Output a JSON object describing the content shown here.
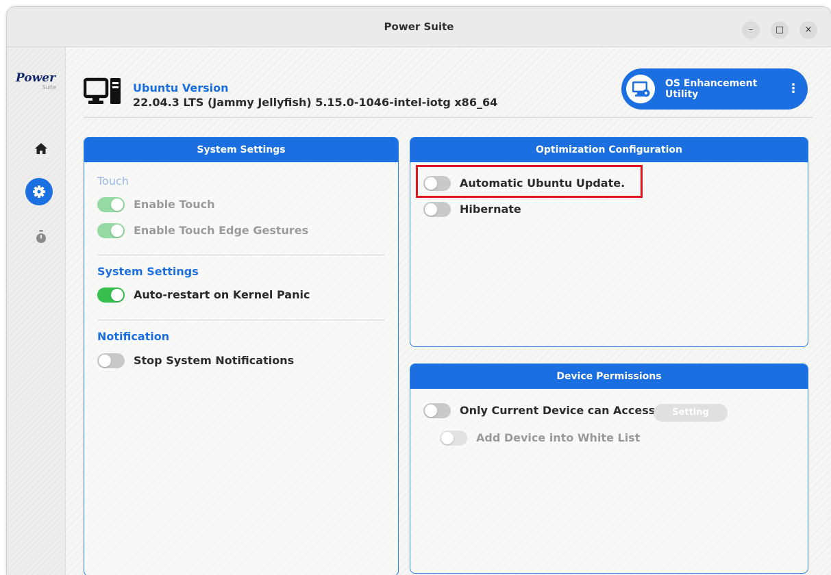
{
  "window": {
    "title": "Power Suite",
    "controls": {
      "minimize": "–",
      "maximize": "□",
      "close": "×"
    }
  },
  "sidebar": {
    "logo": {
      "line1": "Power",
      "line2": "Suite"
    },
    "items": [
      {
        "name": "home",
        "icon": "home-icon",
        "active": false
      },
      {
        "name": "settings",
        "icon": "gear-icon",
        "active": true
      },
      {
        "name": "timer",
        "icon": "stopwatch-icon",
        "active": false
      }
    ]
  },
  "header": {
    "version_label": "Ubuntu Version",
    "version_value": "22.04.3 LTS (Jammy Jellyfish) 5.15.0-1046-intel-iotg x86_64",
    "utility_button": {
      "line1": "OS Enhancement",
      "line2": "Utility",
      "menu": "⋮"
    }
  },
  "system_settings": {
    "title": "System Settings",
    "sections": {
      "touch": {
        "title": "Touch",
        "items": [
          {
            "label": "Enable Touch",
            "on": true,
            "enabled": false
          },
          {
            "label": "Enable Touch Edge Gestures",
            "on": true,
            "enabled": false
          }
        ]
      },
      "system": {
        "title": "System Settings",
        "items": [
          {
            "label": "Auto-restart on Kernel Panic",
            "on": true,
            "enabled": true
          }
        ]
      },
      "notification": {
        "title": "Notification",
        "items": [
          {
            "label": "Stop System Notifications",
            "on": false,
            "enabled": true
          }
        ]
      }
    }
  },
  "optimization": {
    "title": "Optimization Configuration",
    "items": [
      {
        "label": "Automatic Ubuntu Update.",
        "on": false,
        "highlighted": true
      },
      {
        "label": "Hibernate",
        "on": false
      }
    ]
  },
  "device_permissions": {
    "title": "Device Permissions",
    "items": [
      {
        "label": "Only Current Device can Access",
        "on": false,
        "enabled": true
      },
      {
        "label": "Add Device into White List",
        "on": false,
        "enabled": false
      }
    ],
    "setting_button": "Setting"
  },
  "colors": {
    "accent": "#1c6fe0",
    "toggle_on": "#35bf4d",
    "highlight": "#e0141c"
  }
}
